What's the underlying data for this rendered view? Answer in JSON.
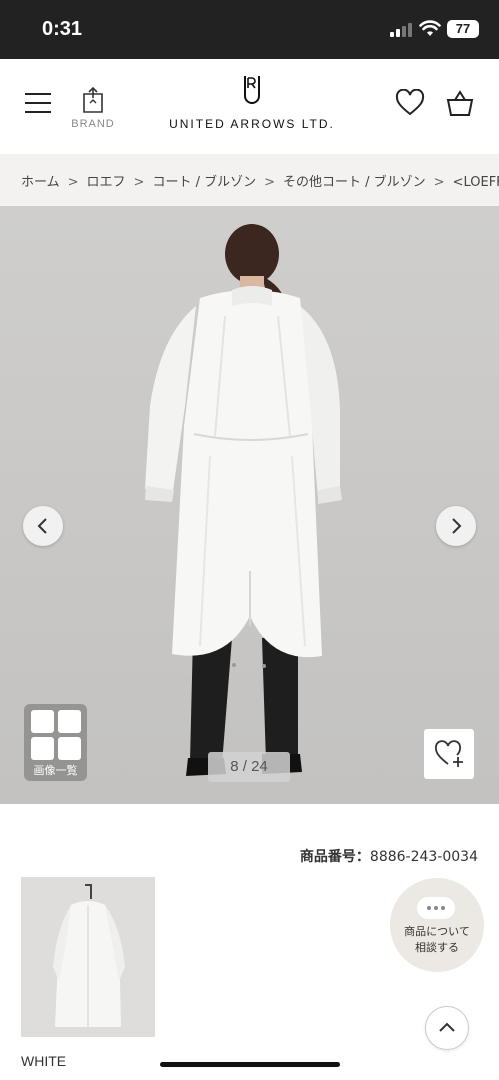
{
  "status_bar": {
    "time": "0:31",
    "battery": "77"
  },
  "header": {
    "brand_label": "BRAND",
    "logo_text": "UNITED ARROWS LTD."
  },
  "breadcrumb": [
    "ホーム",
    "ロエフ",
    "コート / ブルゾン",
    "その他コート / ブルゾン",
    "<LOEFF>"
  ],
  "gallery": {
    "counter": "8 / 24",
    "grid_label": "画像一覧"
  },
  "product": {
    "number_label": "商品番号：",
    "number": "8886-243-0034",
    "color": "WHITE"
  },
  "ask_button": {
    "line1": "商品について",
    "line2": "相談する"
  },
  "colors": {
    "status_bar": "#222222",
    "breadcrumb_bg": "#f3f2f0",
    "photo_bg": "#c8c7c5",
    "ask_button_bg": "#ece8e3"
  },
  "icons": {
    "menu": "hamburger-menu-icon",
    "brand": "brand-tag-icon",
    "favorite": "heart-icon",
    "cart": "shopping-bag-icon",
    "prev": "chevron-left-icon",
    "next": "chevron-right-icon",
    "grid": "grid-icon",
    "add_favorite": "heart-plus-icon",
    "ask": "chat-bubble-icon",
    "top": "chevron-up-icon"
  }
}
